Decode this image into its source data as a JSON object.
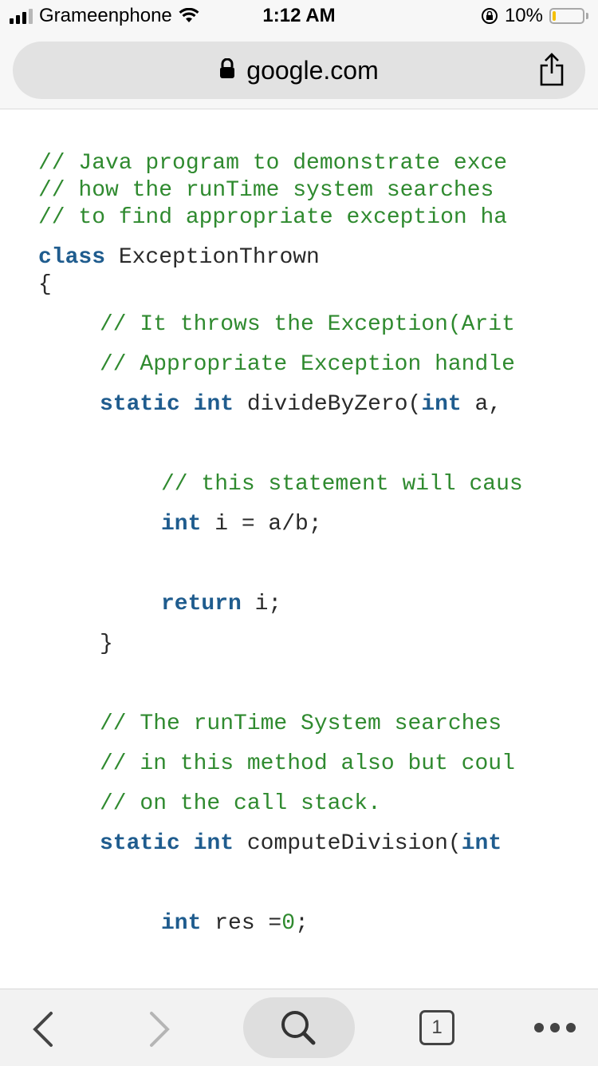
{
  "status_bar": {
    "carrier": "Grameenphone",
    "time": "1:12 AM",
    "battery_percent": "10%",
    "battery_level": 0.1,
    "battery_color": "#f5c000"
  },
  "url_bar": {
    "domain": "google.com",
    "lock_icon": "lock-icon",
    "share_icon": "share-icon"
  },
  "code": {
    "line1": "// Java program to demonstrate exce",
    "line2": "// how the runTime system searches",
    "line3": "// to find appropriate exception ha",
    "line4_kw": "class",
    "line4_rest": " ExceptionThrown",
    "line5": "{",
    "line6": "// It throws the Exception(Arit",
    "line7": "// Appropriate Exception handle",
    "line8_kw1": "static",
    "line8_kw2": "int",
    "line8_mid": " divideByZero(",
    "line8_kw3": "int",
    "line8_end": " a,",
    "line9": "// this statement will caus",
    "line10_kw": "int",
    "line10_rest": " i = a/b;",
    "line11_kw": "return",
    "line11_rest": " i;",
    "line12": "}",
    "line13": "// The runTime System searches",
    "line14": "// in this method also but coul",
    "line15": "// on the call stack.",
    "line16_kw1": "static",
    "line16_kw2": "int",
    "line16_mid": " computeDivision(",
    "line16_kw3": "int",
    "line17_kw": "int",
    "line17_mid": " res =",
    "line17_num": "0",
    "line17_end": ";"
  },
  "toolbar": {
    "tab_count": "1",
    "back_icon": "back-chevron-icon",
    "forward_icon": "forward-chevron-icon",
    "search_icon": "search-icon",
    "menu_icon": "more-dots-icon"
  },
  "colors": {
    "comment": "#2f8a2f",
    "keyword": "#1f5c8e",
    "plain": "#2a2a2a"
  }
}
